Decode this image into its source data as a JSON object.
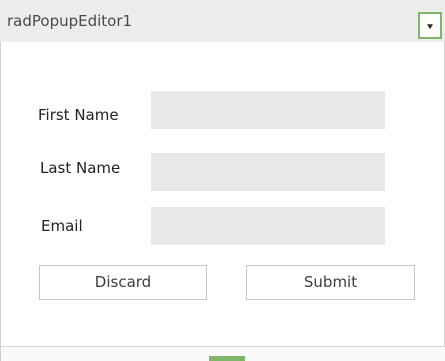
{
  "header": {
    "title": "radPopupEditor1"
  },
  "form": {
    "first_name_label": "First Name",
    "first_name_value": "",
    "last_name_label": "Last Name",
    "last_name_value": "",
    "email_label": "Email",
    "email_value": "",
    "discard_label": "Discard",
    "submit_label": "Submit"
  },
  "icons": {
    "dropdown": "chevron-down-icon",
    "resize_grip": "resize-grip-icon"
  },
  "colors": {
    "accent": "#7fb56a",
    "header_bg": "#ececec",
    "field_bg": "#e8e8e8"
  }
}
